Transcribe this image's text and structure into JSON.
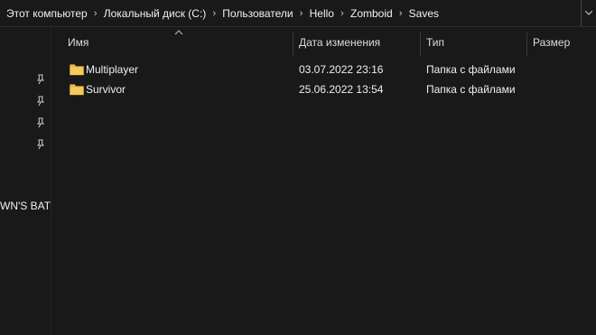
{
  "breadcrumb": [
    {
      "label": "Этот компьютер"
    },
    {
      "label": "Локальный диск (C:)"
    },
    {
      "label": "Пользователи"
    },
    {
      "label": "Hello"
    },
    {
      "label": "Zomboid"
    },
    {
      "label": "Saves"
    }
  ],
  "columns": {
    "name": "Имя",
    "date": "Дата изменения",
    "type": "Тип",
    "size": "Размер"
  },
  "files": [
    {
      "name": "Multiplayer",
      "date": "03.07.2022 23:16",
      "type": "Папка с файлами",
      "icon": "folder-icon"
    },
    {
      "name": "Survivor",
      "date": "25.06.2022 13:54",
      "type": "Папка с файлами",
      "icon": "folder-icon"
    }
  ],
  "nav": {
    "pins": [
      "pin-icon",
      "pin-icon",
      "pin-icon",
      "pin-icon"
    ],
    "truncated_item": "WN'S BATT"
  },
  "colors": {
    "background": "#191919",
    "text": "#f0f0f0",
    "folder": "#e8b94a"
  }
}
